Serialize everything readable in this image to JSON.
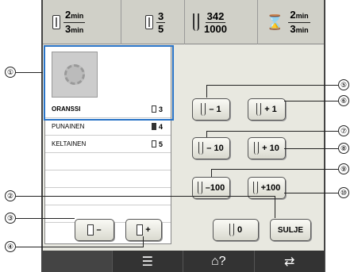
{
  "status": {
    "elapsed": {
      "num": "2",
      "unit": "min",
      "den": "3",
      "den_unit": "min"
    },
    "color_change": {
      "num": "3",
      "den": "5"
    },
    "stitches": {
      "num": "342",
      "den": "1000"
    },
    "time": {
      "num": "2",
      "unit": "min",
      "den": "3",
      "den_unit": "min"
    }
  },
  "thread_list": [
    {
      "name": "ORANSSI",
      "count": "3"
    },
    {
      "name": "PUNAINEN",
      "count": "4"
    },
    {
      "name": "KELTAINEN",
      "count": "5"
    }
  ],
  "buttons": {
    "minus1": "– 1",
    "plus1": "+ 1",
    "minus10": "– 10",
    "plus10": "+ 10",
    "minus100": "–100",
    "plus100": "+100",
    "spool_minus": "–",
    "spool_plus": "+",
    "zero": "0",
    "close": "SULJE"
  },
  "nav": {
    "help": "?"
  },
  "callouts": [
    "①",
    "②",
    "③",
    "④",
    "⑤",
    "⑥",
    "⑦",
    "⑧",
    "⑨",
    "⑩"
  ]
}
